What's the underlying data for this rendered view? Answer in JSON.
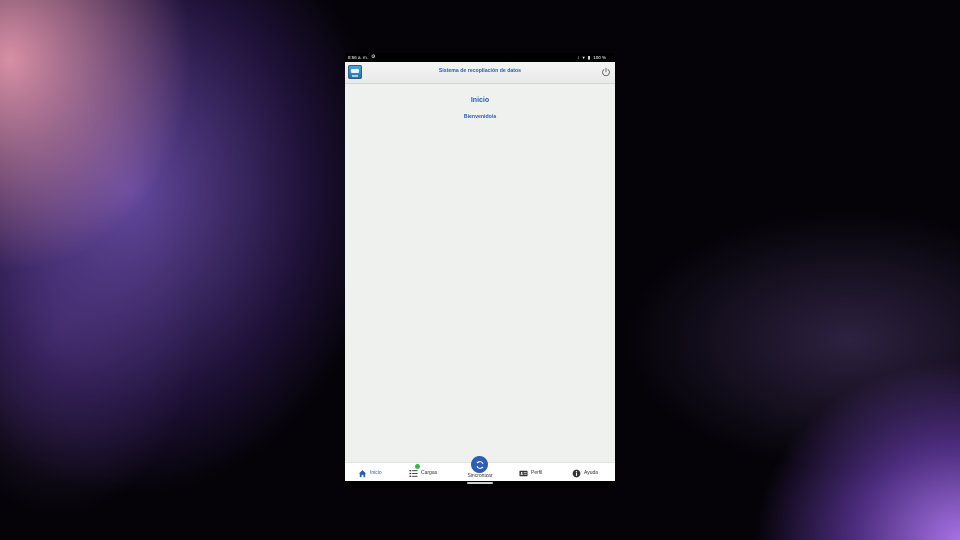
{
  "status_bar": {
    "time": "8:56 a. m.",
    "battery": "100 %",
    "left_icon": "settings-gear-icon",
    "right_icons": [
      "vibrate-icon",
      "wifi-icon",
      "battery-icon"
    ]
  },
  "app_bar": {
    "title": "Sistema de recopilación de datos",
    "logo_icon": "app-logo-icon",
    "action_icon": "power-icon"
  },
  "main": {
    "title": "Inicio",
    "subtitle": "Bienvenido/a"
  },
  "bottom_nav": {
    "items": [
      {
        "label": "Inicio",
        "icon": "home-icon",
        "active": true
      },
      {
        "label": "Cargas",
        "icon": "list-icon",
        "badge": true
      },
      {
        "label": "Sincronizar",
        "icon": "sync-icon"
      },
      {
        "label": "Perfil",
        "icon": "id-card-icon"
      },
      {
        "label": "Ayuda",
        "icon": "info-icon"
      }
    ]
  },
  "colors": {
    "accent": "#2d5eb0",
    "badge": "#3bb54a",
    "content_bg": "#eef1ee"
  }
}
